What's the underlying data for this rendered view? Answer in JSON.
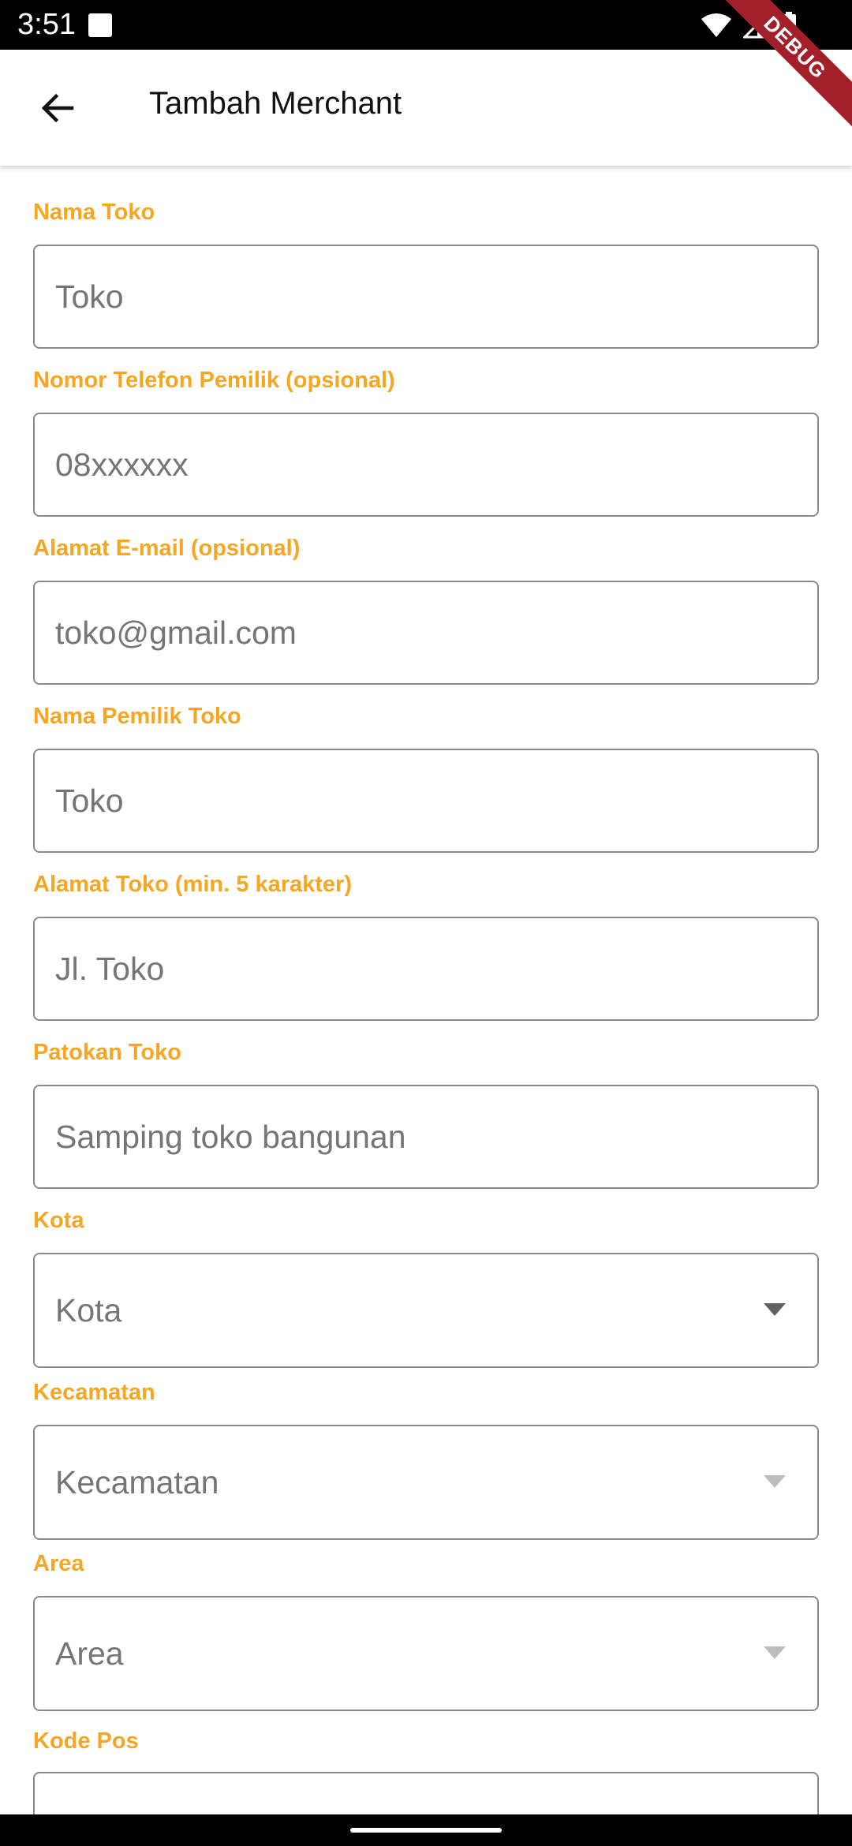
{
  "status_bar": {
    "time": "3:51",
    "icons": [
      "notification-icon",
      "wifi-icon",
      "cellular-signal-icon",
      "battery-icon"
    ]
  },
  "debug_banner": "DEBUG",
  "app_bar": {
    "title": "Tambah Merchant",
    "back_icon": "arrow-back-icon"
  },
  "form": {
    "fields": [
      {
        "label": "Nama Toko",
        "placeholder": "Toko",
        "type": "text"
      },
      {
        "label": "Nomor Telefon Pemilik (opsional)",
        "placeholder": "08xxxxxx",
        "type": "text"
      },
      {
        "label": "Alamat E-mail (opsional)",
        "placeholder": "toko@gmail.com",
        "type": "text"
      },
      {
        "label": "Nama Pemilik Toko",
        "placeholder": "Toko",
        "type": "text"
      },
      {
        "label": "Alamat Toko (min. 5 karakter)",
        "placeholder": "Jl. Toko",
        "type": "text"
      },
      {
        "label": "Patokan Toko",
        "placeholder": "Samping toko bangunan",
        "type": "text"
      },
      {
        "label": "Kota",
        "placeholder": "Kota",
        "type": "dropdown",
        "enabled": true
      },
      {
        "label": "Kecamatan",
        "placeholder": "Kecamatan",
        "type": "dropdown",
        "enabled": false
      },
      {
        "label": "Area",
        "placeholder": "Area",
        "type": "dropdown",
        "enabled": false
      },
      {
        "label": "Kode Pos",
        "placeholder": "",
        "type": "text"
      }
    ]
  },
  "colors": {
    "label": "#f5a623",
    "border": "#8a8a8a",
    "placeholder": "#757575",
    "caret_enabled": "#616161",
    "caret_disabled": "#bdbdbd",
    "debug": "#a3202a"
  }
}
